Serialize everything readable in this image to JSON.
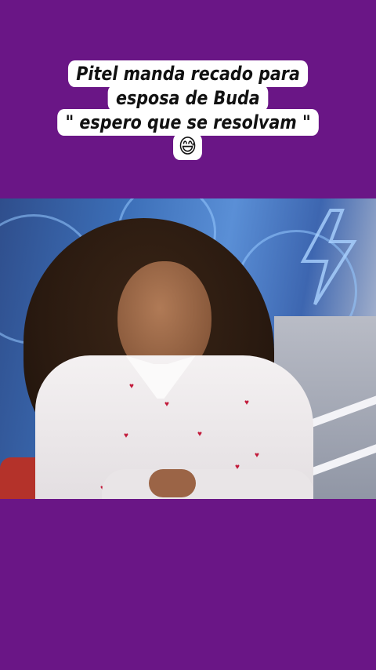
{
  "caption": {
    "line1": "Pitel manda recado para",
    "line2": "esposa de Buda",
    "line3": "\" espero que se resolvam \"",
    "emoji": "😅"
  },
  "colors": {
    "background": "#6a1686",
    "caption_bg": "#ffffff",
    "caption_text": "#111111",
    "video_blue": "#3c6fb8",
    "heart_red": "#c21a3a"
  },
  "video": {
    "subject": "video-frame"
  }
}
